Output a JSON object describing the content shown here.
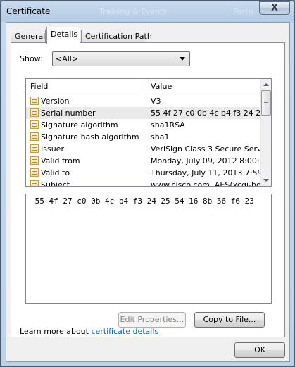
{
  "window": {
    "title": "Certificate",
    "background_title": "Training & Events",
    "background_title_right": "Partn",
    "close_glyph": "X"
  },
  "tabs": [
    {
      "label": "General"
    },
    {
      "label": "Details"
    },
    {
      "label": "Certification Path"
    }
  ],
  "active_tab": "Details",
  "show": {
    "label": "Show:",
    "selected": "<All>"
  },
  "fields_table": {
    "columns": [
      "Field",
      "Value"
    ],
    "rows": [
      {
        "field": "Version",
        "value": "V3"
      },
      {
        "field": "Serial number",
        "value": "55 4f 27 c0 0b 4c b4 f3 24 25 ..."
      },
      {
        "field": "Signature algorithm",
        "value": "sha1RSA"
      },
      {
        "field": "Signature hash algorithm",
        "value": "sha1"
      },
      {
        "field": "Issuer",
        "value": "VeriSign Class 3 Secure Server..."
      },
      {
        "field": "Valid from",
        "value": "Monday, July 09, 2012 8:00:0..."
      },
      {
        "field": "Valid to",
        "value": "Thursday, July 11, 2013 7:59:..."
      },
      {
        "field": "Subject",
        "value": "www.cisco.com, AES(xcgi-bos..."
      }
    ],
    "selected_row": "Serial number"
  },
  "value_text": " 55 4f 27 c0 0b 4c b4 f3 24 25 54 16 8b 56 f6 23",
  "buttons": {
    "edit_properties": "Edit Properties...",
    "copy_to_file": "Copy to File...",
    "ok": "OK"
  },
  "learn_more": {
    "prefix": "Learn more about ",
    "link": "certificate details"
  },
  "colors": {
    "accent_link": "#0066cc",
    "title_bar": "#b9d1ea"
  },
  "icons": {
    "row_icon": "certificate-field-icon",
    "scroll_up": "chevron-up-icon",
    "scroll_down": "chevron-down-icon"
  }
}
